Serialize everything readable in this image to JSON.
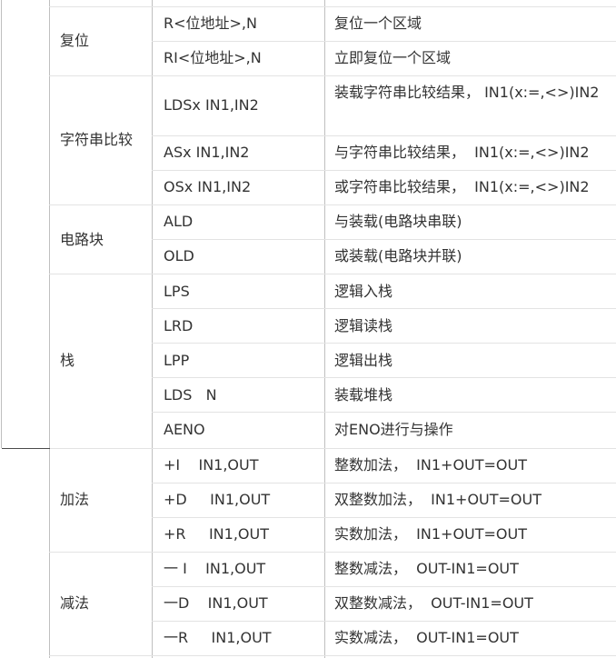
{
  "groups": [
    {
      "name": "复位",
      "rows": [
        {
          "cmd": "R<位地址>,N",
          "desc": "复位一个区域"
        },
        {
          "cmd": "RI<位地址>,N",
          "desc": "立即复位一个区域"
        }
      ]
    },
    {
      "name": "字符串比较",
      "rows": [
        {
          "cmd": "LDSx IN1,IN2",
          "desc": "装载字符串比较结果，  IN1(x:=,<>)IN2"
        },
        {
          "cmd": "ASx IN1,IN2",
          "desc": "与字符串比较结果，  IN1(x:=,<>)IN2"
        },
        {
          "cmd": "OSx IN1,IN2",
          "desc": "或字符串比较结果，  IN1(x:=,<>)IN2"
        }
      ]
    },
    {
      "name": "电路块",
      "rows": [
        {
          "cmd": "ALD",
          "desc": "与装载(电路块串联)"
        },
        {
          "cmd": "OLD",
          "desc": "或装载(电路块并联)"
        }
      ]
    },
    {
      "name": "栈",
      "rows": [
        {
          "cmd": "LPS",
          "desc": "逻辑入栈"
        },
        {
          "cmd": "LRD",
          "desc": "逻辑读栈"
        },
        {
          "cmd": "LPP",
          "desc": "逻辑出栈"
        },
        {
          "cmd": "LDS   N",
          "desc": "装载堆栈"
        },
        {
          "cmd": "AENO",
          "desc": "对ENO进行与操作"
        }
      ]
    },
    {
      "name": "加法",
      "rows": [
        {
          "cmd": "+I    IN1,OUT",
          "desc": "整数加法，  IN1+OUT=OUT"
        },
        {
          "cmd": "+D     IN1,OUT",
          "desc": "双整数加法，  IN1+OUT=OUT"
        },
        {
          "cmd": "+R     IN1,OUT",
          "desc": "实数加法，  IN1+OUT=OUT"
        }
      ]
    },
    {
      "name": "减法",
      "rows": [
        {
          "cmd": "一 I    IN1,OUT",
          "desc": "整数减法，  OUT-IN1=OUT"
        },
        {
          "cmd": "一D    IN1,OUT",
          "desc": "双整数减法，  OUT-IN1=OUT"
        },
        {
          "cmd": "一R     IN1,OUT",
          "desc": "实数减法，  OUT-IN1=OUT"
        }
      ]
    }
  ]
}
